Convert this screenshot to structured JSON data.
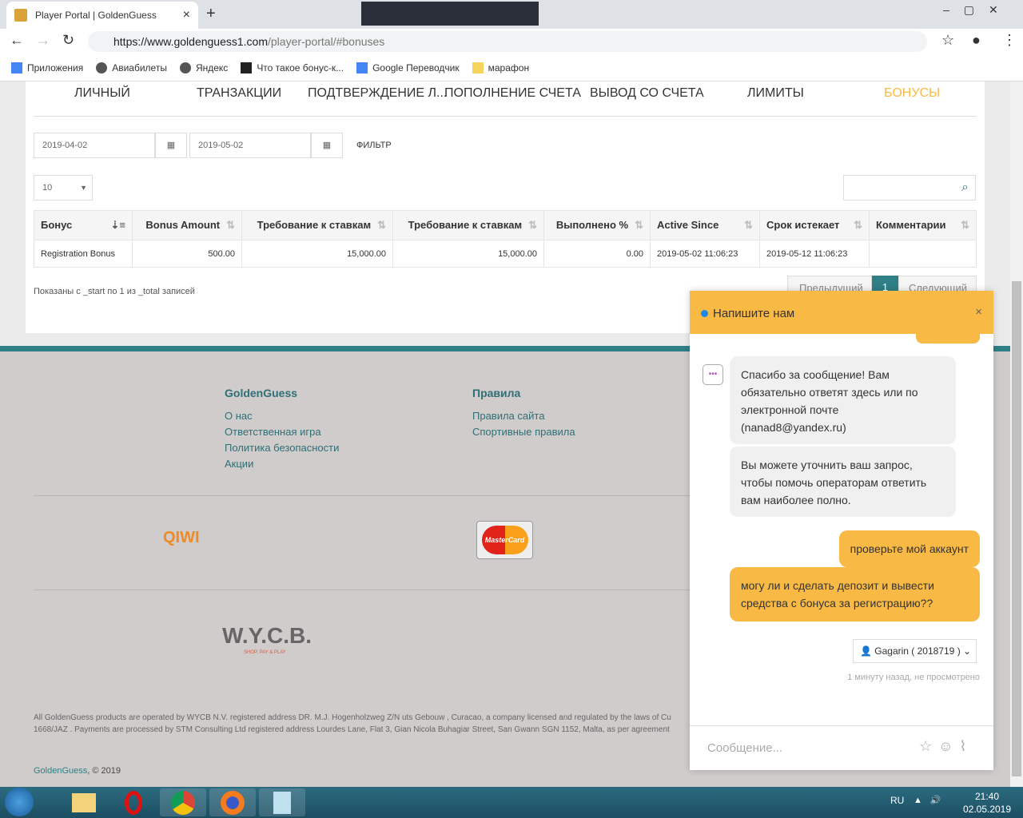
{
  "browser": {
    "tab_title": "Player Portal | GoldenGuess",
    "url_host": "https://www.goldenguess1.com",
    "url_path": "/player-portal/#bonuses",
    "bookmarks": [
      "Приложения",
      "Авиабилеты",
      "Яндекс",
      "Что такое бонус-к...",
      "Google Переводчик",
      "марафон"
    ]
  },
  "nav": {
    "tabs": [
      "ЛИЧНЫЙ",
      "ТРАНЗАКЦИИ",
      "ПОДТВЕРЖДЕНИЕ Л...",
      "ПОПОЛНЕНИЕ СЧЕТА",
      "ВЫВОД СО СЧЕТА",
      "ЛИМИТЫ",
      "БОНУСЫ"
    ],
    "active": "БОНУСЫ"
  },
  "filter": {
    "date_from": "2019-04-02",
    "date_to": "2019-05-02",
    "button": "ФИЛЬТР",
    "page_size": "10"
  },
  "table": {
    "headers": [
      "Бонус",
      "Bonus Amount",
      "Требование к ставкам",
      "Требование к ставкам",
      "Выполнено %",
      "Active Since",
      "Срок истекает",
      "Комментарии"
    ],
    "rows": [
      [
        "Registration Bonus",
        "500.00",
        "15,000.00",
        "15,000.00",
        "0.00",
        "2019-05-02 11:06:23",
        "2019-05-12 11:06:23",
        ""
      ]
    ]
  },
  "pagination": {
    "info": "Показаны с _start по 1 из _total записей",
    "prev": "Предыдущий",
    "page": "1",
    "next": "Следующий"
  },
  "footer": {
    "col1_title": "GoldenGuess",
    "col1_links": [
      "О нас",
      "Ответственная игра",
      "Политика безопасности",
      "Акции"
    ],
    "col2_title": "Правила",
    "col2_links": [
      "Правила сайта",
      "Спортивные правила"
    ],
    "payments": [
      "QIWI",
      "MasterCard"
    ],
    "logo": "W.Y.C.B.",
    "logo_sub": "SHOP, PAY & PLAY",
    "legal1": "All GoldenGuess products are operated by WYCB N.V. registered address DR. M.J. Hogenholzweg Z/N uts Gebouw , Curacao, a company licensed and regulated by the laws of Cu",
    "legal2": "1668/JAZ . Payments are processed by STM Consulting Ltd registered address Lourdes Lane, Flat 3, Gian Nicola Buhagiar Street, San Gwann SGN 1152, Malta, as per agreement",
    "brand": "GoldenGuess",
    "copyright": ", © 2019"
  },
  "chat": {
    "title": "Напишите нам",
    "close": "×",
    "messages": [
      {
        "from": "bot",
        "text": "Спасибо за сообщение! Вам обязательно ответят здесь или по электронной почте (nanad8@yandex.ru)"
      },
      {
        "from": "bot",
        "text": "Вы можете уточнить ваш запрос, чтобы помочь операторам ответить вам наиболее полно."
      },
      {
        "from": "user",
        "text": "проверьте мой аккаунт"
      },
      {
        "from": "user",
        "text": "могу ли и сделать депозит и вывести средства с бонуса за регистрацию??"
      }
    ],
    "account": "Gagarin ( 2018719 )",
    "status": "1 минуту назад, не просмотрено",
    "placeholder": "Сообщение..."
  },
  "taskbar": {
    "lang": "RU",
    "time": "21:40",
    "date": "02.05.2019"
  },
  "colors": {
    "accent": "#f8b945",
    "teal": "#2f7f86",
    "link": "#2f6f77"
  }
}
